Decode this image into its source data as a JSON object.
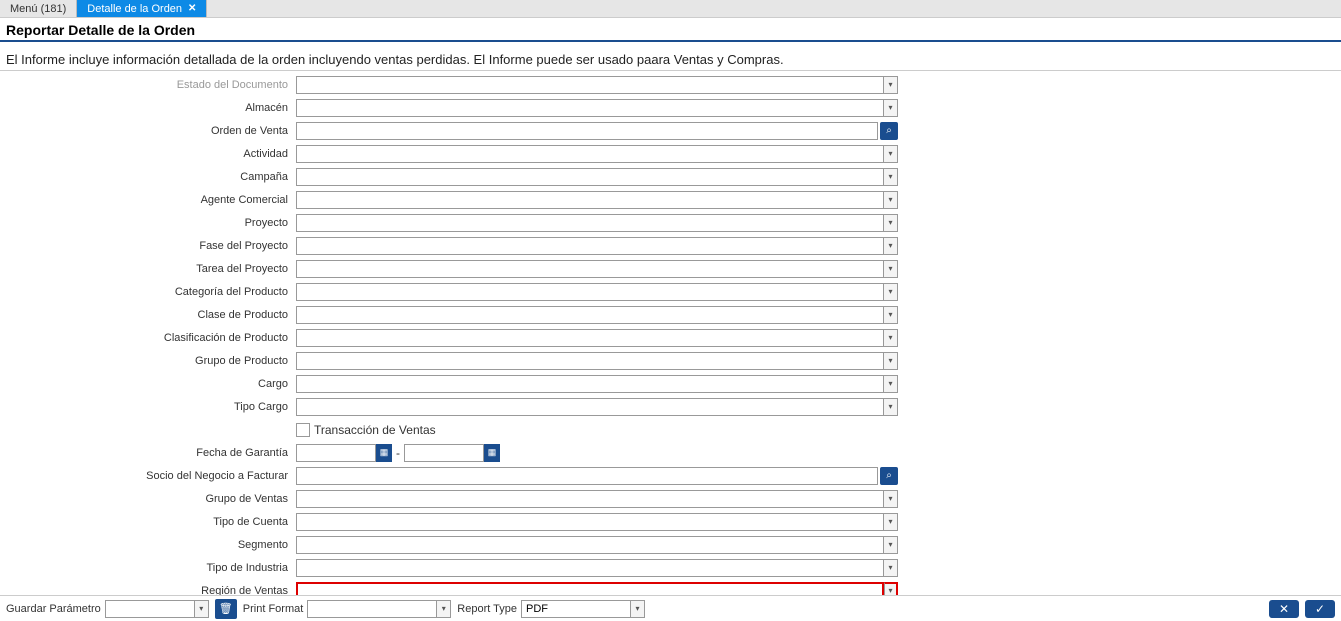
{
  "tabs": {
    "inactive": "Menú (181)",
    "active": "Detalle de la Orden"
  },
  "header": {
    "title": "Reportar Detalle de la Orden",
    "description": "El Informe incluye información detallada de la orden incluyendo ventas perdidas. El Informe puede ser usado paara Ventas y Compras."
  },
  "fields": {
    "estado_documento": "Estado del Documento",
    "almacen": "Almacén",
    "orden_venta": "Orden de Venta",
    "actividad": "Actividad",
    "campana": "Campaña",
    "agente_comercial": "Agente Comercial",
    "proyecto": "Proyecto",
    "fase_proyecto": "Fase del Proyecto",
    "tarea_proyecto": "Tarea del Proyecto",
    "categoria_producto": "Categoría del Producto",
    "clase_producto": "Clase de Producto",
    "clasificacion_producto": "Clasificación de Producto",
    "grupo_producto": "Grupo de Producto",
    "cargo": "Cargo",
    "tipo_cargo": "Tipo Cargo",
    "transaccion_ventas": "Transacción de Ventas",
    "fecha_garantia": "Fecha de Garantía",
    "socio_negocio": "Socio del Negocio a Facturar",
    "grupo_ventas": "Grupo de Ventas",
    "tipo_cuenta": "Tipo de Cuenta",
    "segmento": "Segmento",
    "tipo_industria": "Tipo de Industria",
    "region_ventas": "Región de Ventas"
  },
  "footer": {
    "guardar_parametro": "Guardar Parámetro",
    "print_format": "Print Format",
    "report_type": "Report Type",
    "report_type_value": "PDF"
  }
}
